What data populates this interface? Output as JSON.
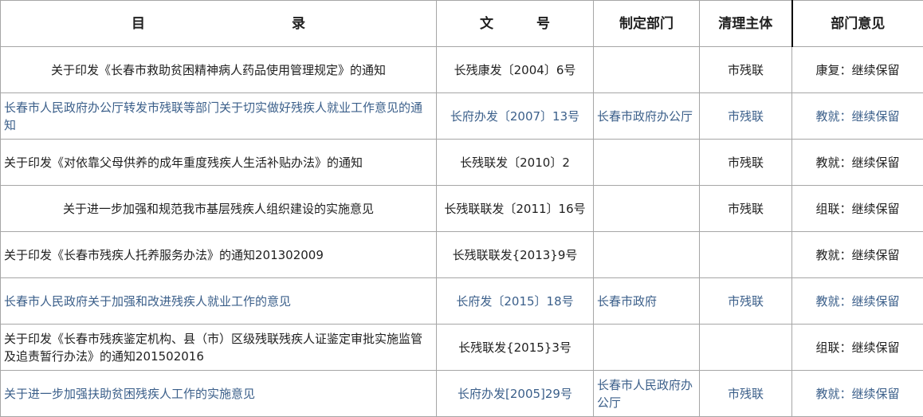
{
  "header": {
    "catalog": [
      "目",
      "录"
    ],
    "docno": [
      "文",
      "号"
    ],
    "dept": "制定部门",
    "subject": "清理主体",
    "opinion": "部门意见"
  },
  "rows": [
    {
      "title": "关于印发《长春市救助贫困精神病人药品使用管理规定》的通知",
      "docno": "长残康发〔2004〕6号",
      "dept": "",
      "subject": "市残联",
      "opinion": "康复：继续保留",
      "blue": false,
      "align": "c"
    },
    {
      "title": "长春市人民政府办公厅转发市残联等部门关于切实做好残疾人就业工作意见的通知",
      "docno": "长府办发〔2007〕13号",
      "dept": "长春市政府办公厅",
      "subject": "市残联",
      "opinion": "教就：继续保留",
      "blue": true,
      "align": "l"
    },
    {
      "title": "关于印发《对依靠父母供养的成年重度残疾人生活补贴办法》的通知",
      "docno": "长残联发〔2010〕2",
      "dept": "",
      "subject": "市残联",
      "opinion": "教就：继续保留",
      "blue": false,
      "align": "l"
    },
    {
      "title": "关于进一步加强和规范我市基层残疾人组织建设的实施意见",
      "docno": "长残联联发〔2011〕16号",
      "dept": "",
      "subject": "市残联",
      "opinion": "组联：继续保留",
      "blue": false,
      "align": "c"
    },
    {
      "title": "关于印发《长春市残疾人托养服务办法》的通知201302009",
      "docno": "长残联联发{2013}9号",
      "dept": "",
      "subject": "",
      "opinion": "教就：继续保留",
      "blue": false,
      "align": "l"
    },
    {
      "title": "长春市人民政府关于加强和改进残疾人就业工作的意见",
      "docno": "长府发〔2015〕18号",
      "dept": "长春市政府",
      "subject": "市残联",
      "opinion": "教就：继续保留",
      "blue": true,
      "align": "l"
    },
    {
      "title": "关于印发《长春市残疾鉴定机构、县（市）区级残联残疾人证鉴定审批实施监管及追责暂行办法》的通知201502016",
      "docno": "长残联发{2015}3号",
      "dept": "",
      "subject": "",
      "opinion": "组联：继续保留",
      "blue": false,
      "align": "l"
    },
    {
      "title": "关于进一步加强扶助贫困残疾人工作的实施意见",
      "docno": "长府办发[2005]29号",
      "dept": "长春市人民政府办公厅",
      "subject": "市残联",
      "opinion": "教就：继续保留",
      "blue": true,
      "align": "l"
    }
  ]
}
